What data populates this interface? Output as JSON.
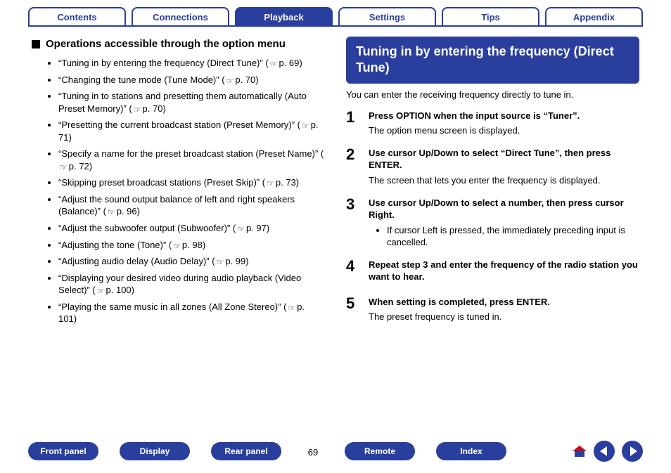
{
  "tabs": {
    "items": [
      {
        "label": "Contents",
        "active": false
      },
      {
        "label": "Connections",
        "active": false
      },
      {
        "label": "Playback",
        "active": true
      },
      {
        "label": "Settings",
        "active": false
      },
      {
        "label": "Tips",
        "active": false
      },
      {
        "label": "Appendix",
        "active": false
      }
    ]
  },
  "left": {
    "heading": "Operations accessible through the option menu",
    "items": [
      {
        "text": "“Tuning in by entering the frequency (Direct Tune)”",
        "page": "p. 69"
      },
      {
        "text": "“Changing the tune mode (Tune Mode)”",
        "page": "p. 70"
      },
      {
        "text": "“Tuning in to stations and presetting them automatically (Auto Preset Memory)”",
        "page": "p. 70"
      },
      {
        "text": "“Presetting the current broadcast station (Preset Memory)”",
        "page": "p. 71"
      },
      {
        "text": "“Specify a name for the preset broadcast station (Preset Name)”",
        "page": "p. 72"
      },
      {
        "text": "“Skipping preset broadcast stations (Preset Skip)”",
        "page": "p. 73"
      },
      {
        "text": "“Adjust the sound output balance of left and right speakers (Balance)”",
        "page": "p. 96"
      },
      {
        "text": "“Adjust the subwoofer output (Subwoofer)”",
        "page": "p. 97"
      },
      {
        "text": "“Adjusting the tone (Tone)”",
        "page": "p. 98"
      },
      {
        "text": "“Adjusting audio delay (Audio Delay)”",
        "page": "p. 99"
      },
      {
        "text": "“Displaying your desired video during audio playback (Video Select)”",
        "page": "p. 100"
      },
      {
        "text": "“Playing the same music in all zones (All Zone Stereo)”",
        "page": "p. 101"
      }
    ]
  },
  "right": {
    "title": "Tuning in by entering the frequency (Direct Tune)",
    "lead": "You can enter the receiving frequency directly to tune in.",
    "steps": [
      {
        "num": "1",
        "head": "Press OPTION when the input source is “Tuner”.",
        "desc": "The option menu screen is displayed."
      },
      {
        "num": "2",
        "head": "Use cursor Up/Down to select “Direct Tune”, then press ENTER.",
        "desc": "The screen that lets you enter the frequency is displayed."
      },
      {
        "num": "3",
        "head": "Use cursor Up/Down to select a number, then press cursor Right.",
        "sub": [
          "If cursor Left is pressed, the immediately preceding input is cancelled."
        ]
      },
      {
        "num": "4",
        "head": "Repeat step 3 and enter the frequency of the radio station you want to hear."
      },
      {
        "num": "5",
        "head": "When setting is completed, press ENTER.",
        "desc": "The preset frequency is tuned in."
      }
    ]
  },
  "bottom": {
    "items": [
      "Front panel",
      "Display",
      "Rear panel",
      "Remote",
      "Index"
    ],
    "page_number": "69"
  }
}
